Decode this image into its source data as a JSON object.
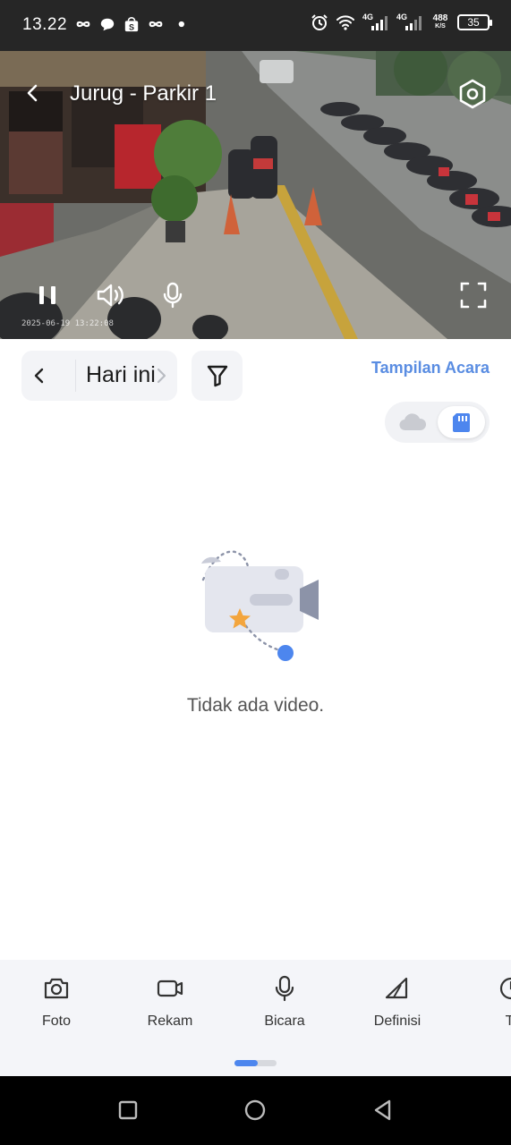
{
  "status_bar": {
    "time": "13.22",
    "left_icons": [
      "infinity-icon",
      "chat-bubble-icon",
      "shopee-bag-icon",
      "infinity-icon",
      "dot-icon"
    ],
    "right_icons": [
      "alarm-icon",
      "wifi-icon",
      "signal-4g-icon",
      "signal-4g-icon"
    ],
    "network_1": "4G",
    "network_2": "4G",
    "speed_value": "488",
    "speed_unit": "K/S",
    "battery": "35"
  },
  "camera": {
    "title": "Jurug - Parkir 1",
    "timestamp": "2025-06-19 13:22:08",
    "controls": [
      "pause-icon",
      "volume-icon",
      "microphone-icon",
      "fullscreen-icon"
    ]
  },
  "playback": {
    "date_label": "Hari ini",
    "event_view_label": "Tampilan Acara",
    "storage_options": [
      "cloud-icon",
      "sd-card-icon"
    ],
    "storage_selected": "sd-card-icon"
  },
  "empty_state": {
    "message": "Tidak ada video."
  },
  "toolbar": {
    "items": [
      {
        "label": "Foto",
        "icon": "camera-icon"
      },
      {
        "label": "Rekam",
        "icon": "video-record-icon"
      },
      {
        "label": "Bicara",
        "icon": "microphone-icon"
      },
      {
        "label": "Definisi",
        "icon": "definition-icon"
      },
      {
        "label": "Ti",
        "icon": "timer-icon"
      }
    ],
    "page_index": 1,
    "page_count": 2
  },
  "colors": {
    "accent": "#4d86ee",
    "link": "#5a8de2",
    "statusbar": "#262626",
    "toolbar_bg": "#f4f5f9"
  }
}
